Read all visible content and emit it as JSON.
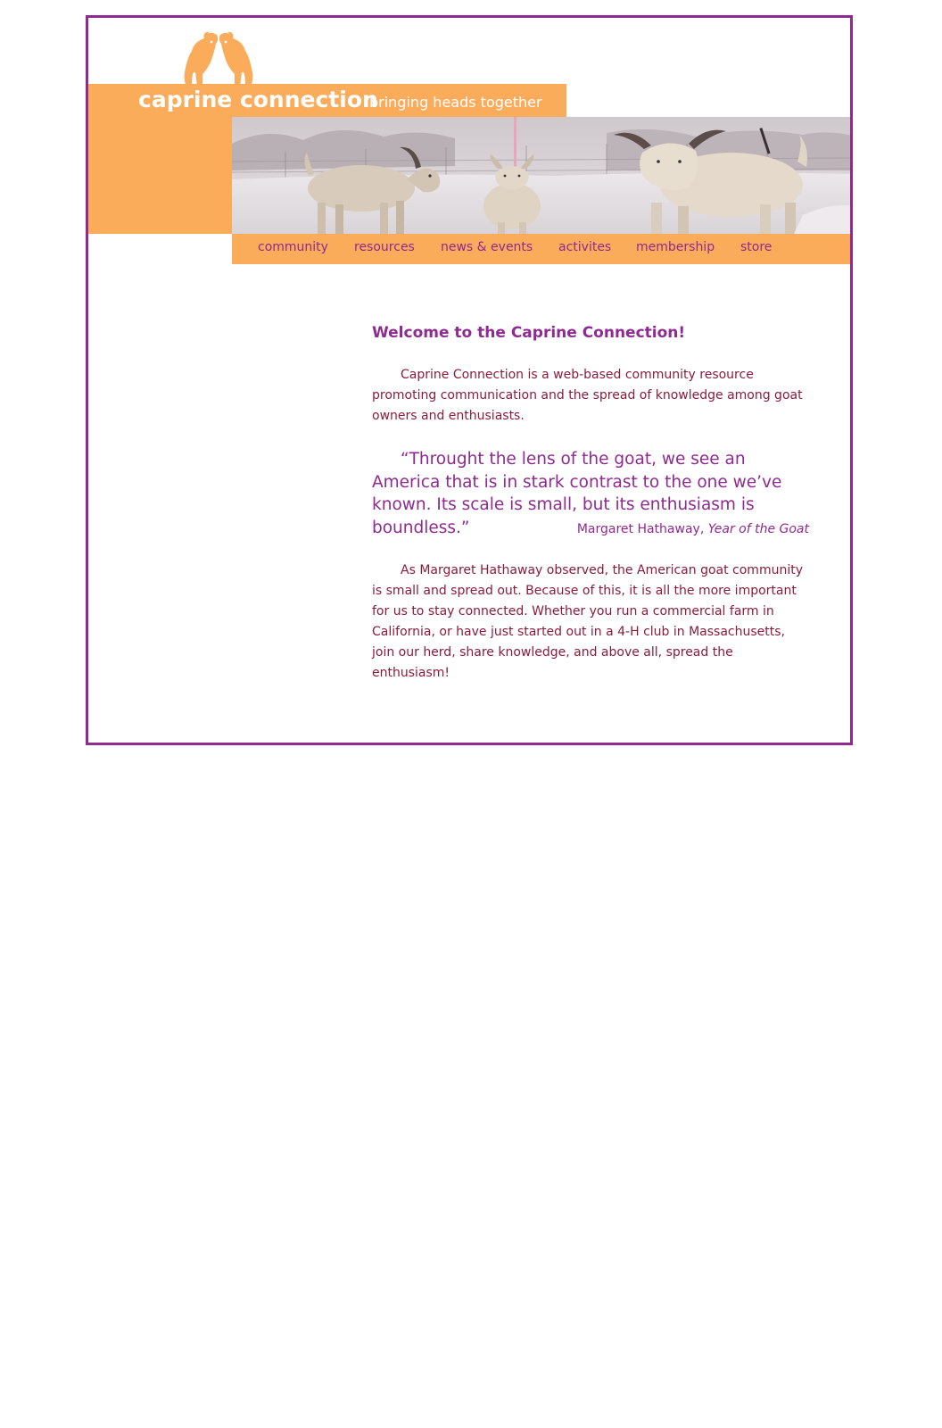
{
  "header": {
    "site_name": "caprine connection",
    "tagline": "bringing heads together"
  },
  "nav": {
    "items": [
      {
        "label": "community"
      },
      {
        "label": "resources"
      },
      {
        "label": "news & events"
      },
      {
        "label": "activites"
      },
      {
        "label": "membership"
      },
      {
        "label": "store"
      }
    ]
  },
  "main": {
    "heading": "Welcome to the Caprine Connection!",
    "intro": "Caprine Connection is a web-based community resource promoting communication and the spread of knowledge among goat owners and enthusiasts.",
    "quote": "“Throught the lens of the goat, we see an America that is in stark contrast to the one we’ve known. Its scale is small, but its enthusiasm is boundless.”",
    "attribution_author": "Margaret Hathaway, ",
    "attribution_title": "Year of the Goat",
    "body": "As Margaret Hathaway observed, the American goat community is small and spread out. Because of this, it is all the more important for us to stay connected. Whether you run a commercial farm in California, or have just started out in a 4-H club in Massachusetts, join our herd, share knowledge, and above all, spread the enthusiasm!"
  },
  "colors": {
    "accent_orange": "#fbac5b",
    "accent_purple": "#8e2a90",
    "text_maroon": "#8a1c3a"
  },
  "icons": {
    "logo": "two-goats-logo",
    "banner": "goats-in-snow-photo"
  }
}
